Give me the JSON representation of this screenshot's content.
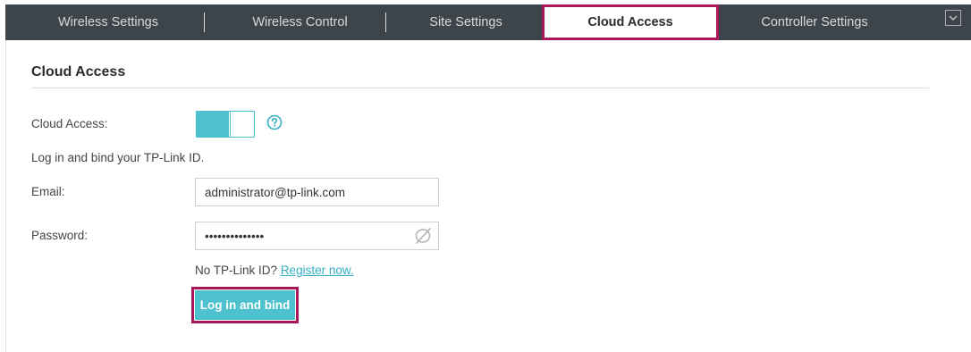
{
  "nav": {
    "tabs": [
      {
        "label": "Wireless Settings"
      },
      {
        "label": "Wireless Control"
      },
      {
        "label": "Site Settings"
      },
      {
        "label": "Cloud Access"
      },
      {
        "label": "Controller Settings"
      }
    ],
    "active_tab": "Cloud Access",
    "dropdown_icon": "chevron-down-icon"
  },
  "section": {
    "title": "Cloud Access"
  },
  "form": {
    "cloud_access_label": "Cloud Access:",
    "cloud_access_enabled": true,
    "help_icon": "question-circle-icon",
    "bind_hint": "Log in and bind your TP-Link ID.",
    "email_label": "Email:",
    "email_value": "administrator@tp-link.com",
    "password_label": "Password:",
    "password_value": "••••••••••••••",
    "password_visibility_icon": "eye-slash-icon",
    "no_id_text": "No TP-Link ID?",
    "register_link": "Register now.",
    "submit_label": "Log in and bind"
  },
  "colors": {
    "navbar_bg": "#3d454b",
    "accent": "#4ec1cf",
    "highlight_border": "#a8175b"
  }
}
